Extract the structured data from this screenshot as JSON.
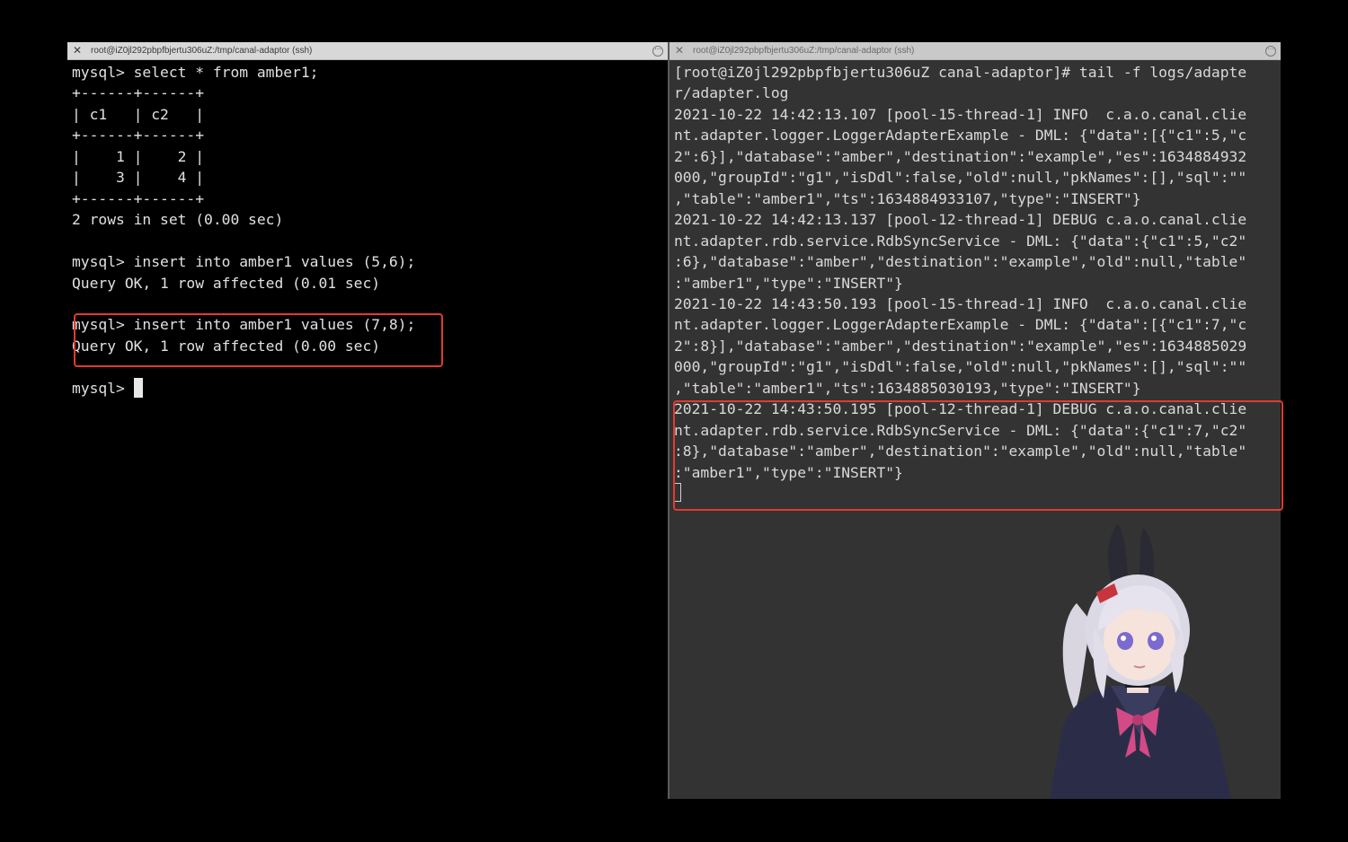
{
  "left_pane": {
    "tab_title": "root@iZ0jl292pbpfbjertu306uZ:/tmp/canal-adaptor (ssh)",
    "lines": [
      "mysql> select * from amber1;",
      "+------+------+",
      "| c1   | c2   |",
      "+------+------+",
      "|    1 |    2 |",
      "|    3 |    4 |",
      "+------+------+",
      "2 rows in set (0.00 sec)",
      "",
      "mysql> insert into amber1 values (5,6);",
      "Query OK, 1 row affected (0.01 sec)",
      "",
      "mysql> insert into amber1 values (7,8);",
      "Query OK, 1 row affected (0.00 sec)",
      ""
    ],
    "prompt": "mysql> "
  },
  "right_pane": {
    "tab_title": "root@iZ0jl292pbpfbjertu306uZ:/tmp/canal-adaptor (ssh)",
    "lines": [
      "[root@iZ0jl292pbpfbjertu306uZ canal-adaptor]# tail -f logs/adapte",
      "r/adapter.log",
      "2021-10-22 14:42:13.107 [pool-15-thread-1] INFO  c.a.o.canal.clie",
      "nt.adapter.logger.LoggerAdapterExample - DML: {\"data\":[{\"c1\":5,\"c",
      "2\":6}],\"database\":\"amber\",\"destination\":\"example\",\"es\":1634884932",
      "000,\"groupId\":\"g1\",\"isDdl\":false,\"old\":null,\"pkNames\":[],\"sql\":\"\"",
      ",\"table\":\"amber1\",\"ts\":1634884933107,\"type\":\"INSERT\"}",
      "2021-10-22 14:42:13.137 [pool-12-thread-1] DEBUG c.a.o.canal.clie",
      "nt.adapter.rdb.service.RdbSyncService - DML: {\"data\":{\"c1\":5,\"c2\"",
      ":6},\"database\":\"amber\",\"destination\":\"example\",\"old\":null,\"table\"",
      ":\"amber1\",\"type\":\"INSERT\"}",
      "2021-10-22 14:43:50.193 [pool-15-thread-1] INFO  c.a.o.canal.clie",
      "nt.adapter.logger.LoggerAdapterExample - DML: {\"data\":[{\"c1\":7,\"c",
      "2\":8}],\"database\":\"amber\",\"destination\":\"example\",\"es\":1634885029",
      "000,\"groupId\":\"g1\",\"isDdl\":false,\"old\":null,\"pkNames\":[],\"sql\":\"\"",
      ",\"table\":\"amber1\",\"ts\":1634885030193,\"type\":\"INSERT\"}",
      "2021-10-22 14:43:50.195 [pool-12-thread-1] DEBUG c.a.o.canal.clie",
      "nt.adapter.rdb.service.RdbSyncService - DML: {\"data\":{\"c1\":7,\"c2\"",
      ":8},\"database\":\"amber\",\"destination\":\"example\",\"old\":null,\"table\"",
      ":\"amber1\",\"type\":\"INSERT\"}"
    ]
  },
  "colors": {
    "highlight": "#e23a2f",
    "left_bg": "#000000",
    "right_bg": "#333333"
  },
  "icons": {
    "tab_close": "close-icon",
    "tab_menu": "more-options-icon"
  }
}
